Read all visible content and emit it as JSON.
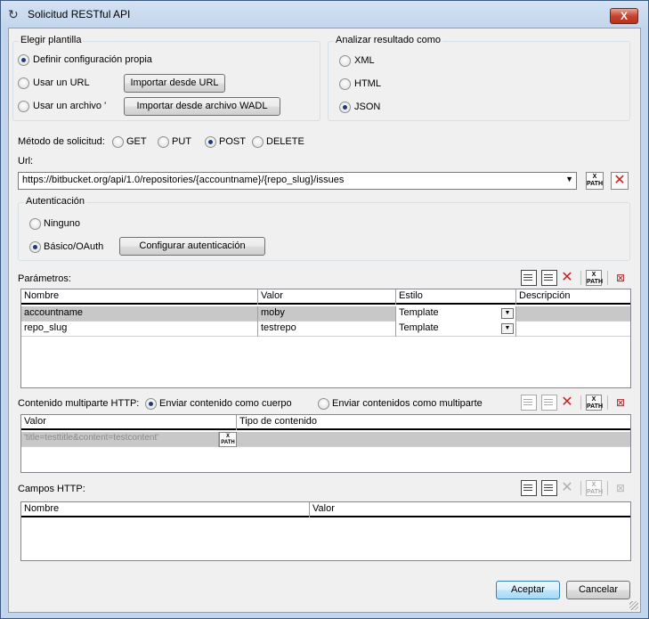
{
  "window": {
    "title": "Solicitud RESTful API",
    "close_glyph": "X"
  },
  "template_group": {
    "label": "Elegir plantilla",
    "option_custom": "Definir configuración propia",
    "option_url": "Usar un URL",
    "option_file": "Usar un archivo '",
    "import_url_button": "Importar desde URL",
    "import_wadl_button": "Importar desde archivo WADL"
  },
  "parse_group": {
    "label": "Analizar resultado como",
    "option_xml": "XML",
    "option_html": "HTML",
    "option_json": "JSON"
  },
  "method": {
    "label": "Método de solicitud:",
    "get": "GET",
    "put": "PUT",
    "post": "POST",
    "delete": "DELETE"
  },
  "url": {
    "label": "Url:",
    "value": "https://bitbucket.org/api/1.0/repositories/{accountname}/{repo_slug}/issues"
  },
  "auth_group": {
    "label": "Autenticación",
    "option_none": "Ninguno",
    "option_basic": "Básico/OAuth",
    "configure_button": "Configurar autenticación"
  },
  "params": {
    "label": "Parámetros:",
    "columns": [
      "Nombre",
      "Valor",
      "Estilo",
      "Descripción"
    ],
    "rows": [
      {
        "name": "accountname",
        "value": "moby",
        "style": "Template",
        "description": ""
      },
      {
        "name": "repo_slug",
        "value": "testrepo",
        "style": "Template",
        "description": ""
      }
    ]
  },
  "multipart": {
    "label": "Contenido multiparte HTTP:",
    "option_body": "Enviar contenido como cuerpo",
    "option_multipart": "Enviar contenidos como multiparte",
    "columns": [
      "Valor",
      "Tipo de contenido"
    ],
    "row_value": "'title=testtitle&content=testcontent'"
  },
  "fields": {
    "label": "Campos HTTP:",
    "columns": [
      "Nombre",
      "Valor"
    ]
  },
  "footer": {
    "ok": "Aceptar",
    "cancel": "Cancelar"
  },
  "icons": {
    "xpath_label": "X PATH"
  }
}
